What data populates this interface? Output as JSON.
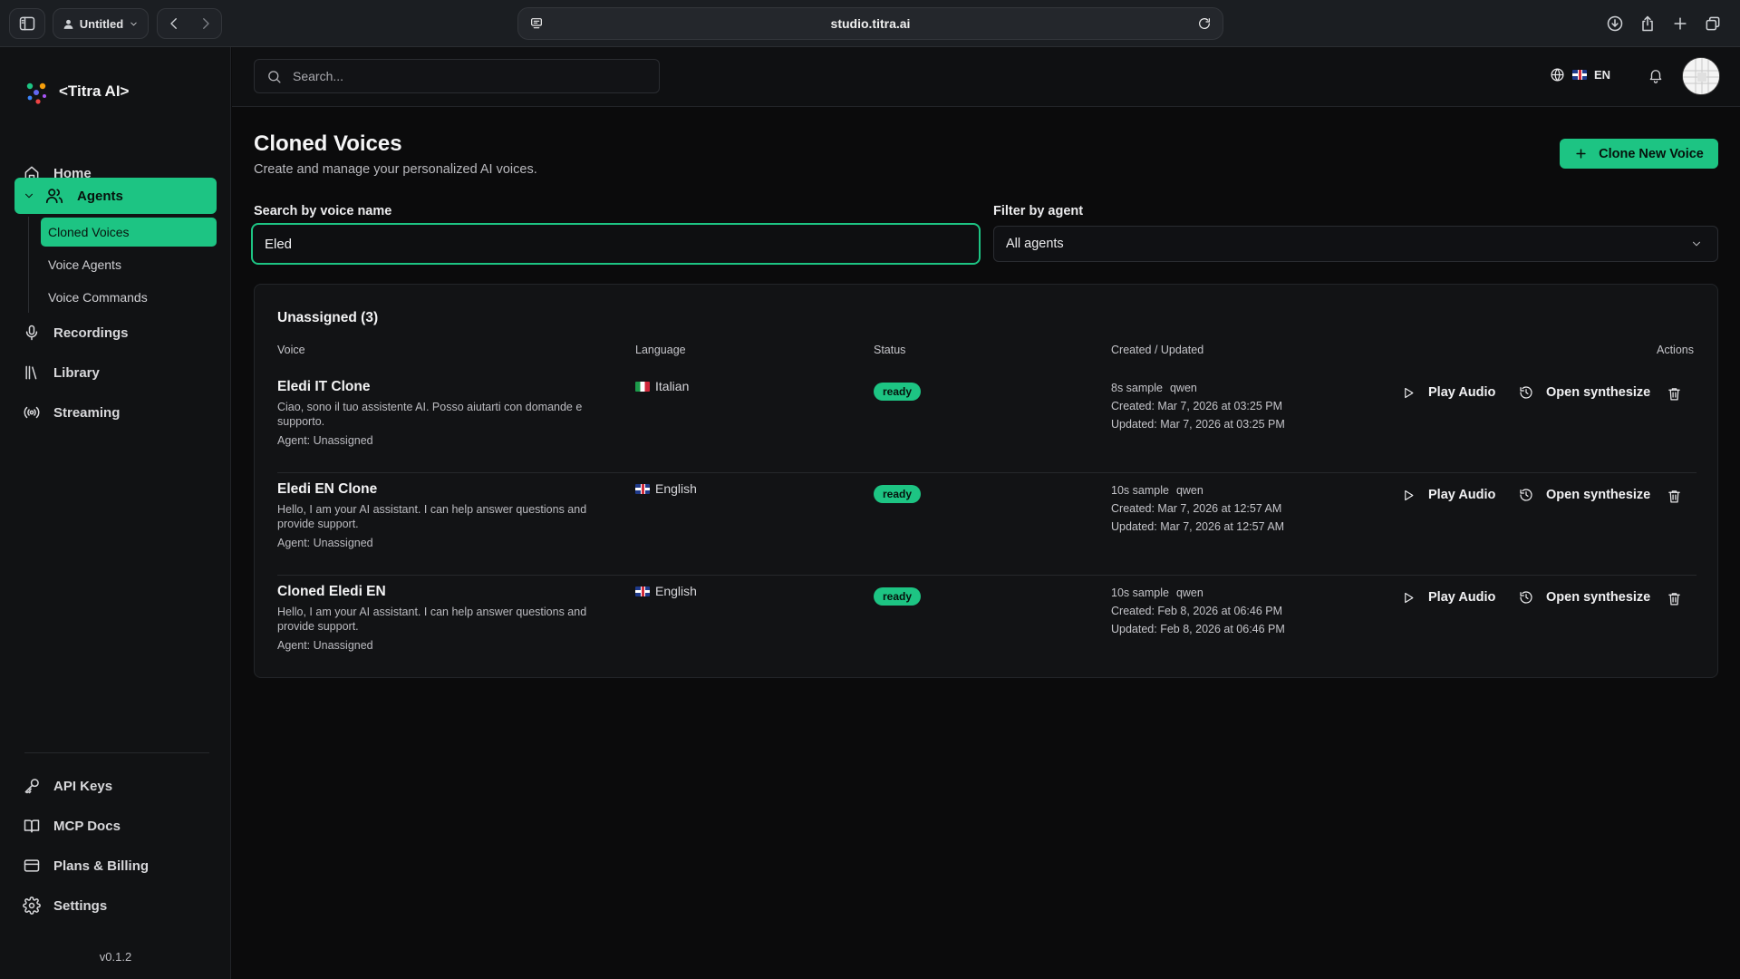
{
  "browser": {
    "profile": "Untitled",
    "url": "studio.titra.ai"
  },
  "brand": {
    "name": "<Titra AI>"
  },
  "sidebar": {
    "items": [
      {
        "label": "Home",
        "icon": "home-icon"
      },
      {
        "label": "Agents",
        "icon": "users-icon",
        "expanded": true
      },
      {
        "label": "Recordings",
        "icon": "mic-icon"
      },
      {
        "label": "Library",
        "icon": "library-icon"
      },
      {
        "label": "Streaming",
        "icon": "broadcast-icon"
      }
    ],
    "subitems": [
      {
        "label": "Cloned Voices",
        "active": true
      },
      {
        "label": "Voice Agents"
      },
      {
        "label": "Voice Commands"
      }
    ],
    "bottom": [
      {
        "label": "API Keys",
        "icon": "key-icon"
      },
      {
        "label": "MCP Docs",
        "icon": "book-icon"
      },
      {
        "label": "Plans & Billing",
        "icon": "card-icon"
      },
      {
        "label": "Settings",
        "icon": "gear-icon"
      }
    ],
    "version": "v0.1.2"
  },
  "header": {
    "search_placeholder": "Search...",
    "language": "EN"
  },
  "page": {
    "title": "Cloned Voices",
    "subtitle": "Create and manage your personalized AI voices.",
    "clone_button": "Clone New Voice",
    "search_label": "Search by voice name",
    "search_value": "Eled",
    "filter_label": "Filter by agent",
    "filter_value": "All agents"
  },
  "table": {
    "group_title": "Unassigned (3)",
    "columns": {
      "voice": "Voice",
      "language": "Language",
      "status": "Status",
      "created": "Created / Updated",
      "actions": "Actions"
    },
    "play_label": "Play Audio",
    "synth_label": "Open synthesize",
    "rows": [
      {
        "name": "Eledi IT Clone",
        "description": "Ciao, sono il tuo assistente AI. Posso aiutarti con domande e supporto.",
        "agent": "Agent: Unassigned",
        "language": "Italian",
        "flag": "it",
        "status": "ready",
        "sample": "8s sample",
        "model": "qwen",
        "created": "Created: Mar 7, 2026 at 03:25 PM",
        "updated": "Updated: Mar 7, 2026 at 03:25 PM"
      },
      {
        "name": "Eledi EN Clone",
        "description": "Hello, I am your AI assistant. I can help answer questions and provide support.",
        "agent": "Agent: Unassigned",
        "language": "English",
        "flag": "uk",
        "status": "ready",
        "sample": "10s sample",
        "model": "qwen",
        "created": "Created: Mar 7, 2026 at 12:57 AM",
        "updated": "Updated: Mar 7, 2026 at 12:57 AM"
      },
      {
        "name": "Cloned Eledi EN",
        "description": "Hello, I am your AI assistant. I can help answer questions and provide support.",
        "agent": "Agent: Unassigned",
        "language": "English",
        "flag": "uk",
        "status": "ready",
        "sample": "10s sample",
        "model": "qwen",
        "created": "Created: Feb 8, 2026 at 06:46 PM",
        "updated": "Updated: Feb 8, 2026 at 06:46 PM"
      }
    ]
  },
  "colors": {
    "accent": "#1dc483",
    "background": "#0b0b0c",
    "panel": "#121315"
  }
}
